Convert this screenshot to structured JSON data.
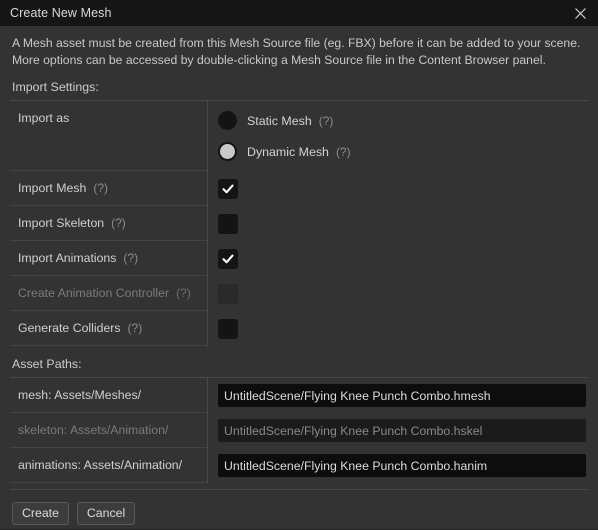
{
  "window": {
    "title": "Create New Mesh",
    "close_icon": "close-icon"
  },
  "description": "A Mesh asset must be created from this Mesh Source file (eg. FBX) before it can be added to your scene. More options can be accessed by double-clicking a Mesh Source file in the Content Browser panel.",
  "sections": {
    "import_settings_label": "Import Settings:",
    "asset_paths_label": "Asset Paths:"
  },
  "import_settings": {
    "import_as": {
      "label": "Import as",
      "options": [
        {
          "label": "Static Mesh",
          "help": "(?)",
          "selected": false
        },
        {
          "label": "Dynamic Mesh",
          "help": "(?)",
          "selected": true
        }
      ]
    },
    "checkboxes": [
      {
        "label": "Import Mesh",
        "help": "(?)",
        "checked": true,
        "disabled": false
      },
      {
        "label": "Import Skeleton",
        "help": "(?)",
        "checked": false,
        "disabled": false
      },
      {
        "label": "Import Animations",
        "help": "(?)",
        "checked": true,
        "disabled": false
      },
      {
        "label": "Create Animation Controller",
        "help": "(?)",
        "checked": false,
        "disabled": true
      },
      {
        "label": "Generate Colliders",
        "help": "(?)",
        "checked": false,
        "disabled": false
      }
    ]
  },
  "asset_paths": {
    "rows": [
      {
        "label": "mesh: Assets/Meshes/",
        "value": "UntitledScene/Flying Knee Punch Combo.hmesh",
        "disabled": false
      },
      {
        "label": "skeleton: Assets/Animation/",
        "value": "UntitledScene/Flying Knee Punch Combo.hskel",
        "disabled": true
      },
      {
        "label": "animations: Assets/Animation/",
        "value": "UntitledScene/Flying Knee Punch Combo.hanim",
        "disabled": false
      }
    ]
  },
  "footer": {
    "create_label": "Create",
    "cancel_label": "Cancel"
  },
  "colors": {
    "window_background": "#333333",
    "titlebar_background": "#151515",
    "input_background": "#0d0d0d",
    "input_background_disabled": "#1b1b1b",
    "divider": "#4a4a4a",
    "text_primary": "#d3d3d3",
    "text_disabled": "#7b7b7b",
    "check_mark": "#ffffff",
    "radio_selected": "#c8c8c8"
  }
}
